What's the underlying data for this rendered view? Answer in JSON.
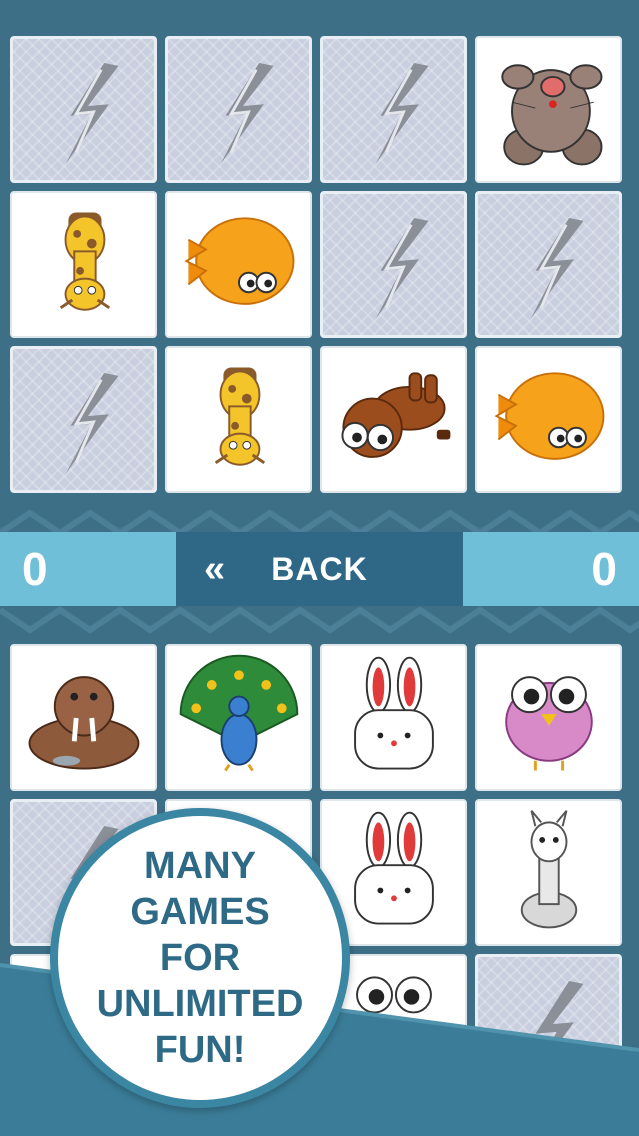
{
  "theme": {
    "background": "#3d6f86",
    "score_panel": "#6fbfd8",
    "bar": "#2f6886",
    "badge_text": "#2e6a86"
  },
  "top_board": {
    "cards": [
      {
        "state": "hidden",
        "animal": ""
      },
      {
        "state": "hidden",
        "animal": ""
      },
      {
        "state": "hidden",
        "animal": ""
      },
      {
        "state": "revealed",
        "animal": "mouse"
      },
      {
        "state": "revealed",
        "animal": "giraffe"
      },
      {
        "state": "revealed",
        "animal": "pufferfish"
      },
      {
        "state": "hidden",
        "animal": ""
      },
      {
        "state": "hidden",
        "animal": ""
      },
      {
        "state": "hidden",
        "animal": ""
      },
      {
        "state": "revealed",
        "animal": "giraffe"
      },
      {
        "state": "revealed",
        "animal": "monkey"
      },
      {
        "state": "revealed",
        "animal": "pufferfish"
      }
    ]
  },
  "scorebar": {
    "player1_score": "0",
    "player2_score": "0",
    "back_icon": "double-chevron-left-icon",
    "back_label": "BACK"
  },
  "bottom_board": {
    "cards": [
      {
        "state": "revealed",
        "animal": "walrus"
      },
      {
        "state": "revealed",
        "animal": "peacock"
      },
      {
        "state": "revealed",
        "animal": "rabbit"
      },
      {
        "state": "revealed",
        "animal": "owl"
      },
      {
        "state": "hidden",
        "animal": ""
      },
      {
        "state": "revealed",
        "animal": ""
      },
      {
        "state": "revealed",
        "animal": "rabbit"
      },
      {
        "state": "revealed",
        "animal": "llama"
      },
      {
        "state": "hidden",
        "animal": ""
      },
      {
        "state": "revealed",
        "animal": ""
      },
      {
        "state": "revealed",
        "animal": "owl"
      },
      {
        "state": "hidden",
        "animal": ""
      }
    ]
  },
  "promo": {
    "line1": "MANY GAMES",
    "line2": "FOR UNLIMITED",
    "line3": "FUN!"
  }
}
